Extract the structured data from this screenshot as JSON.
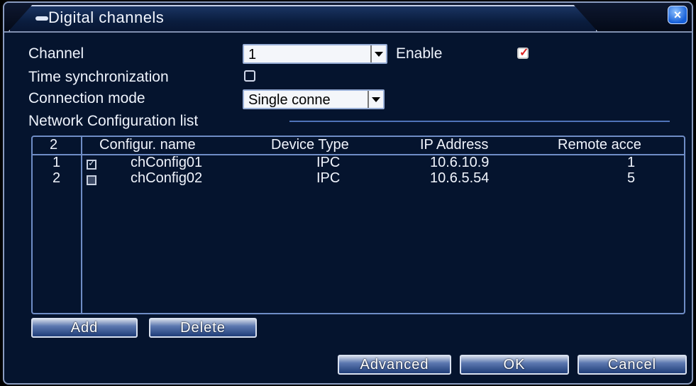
{
  "window": {
    "title": "Digital channels",
    "close_label": "×"
  },
  "form": {
    "channel_label": "Channel",
    "channel_value": "1",
    "enable_label": "Enable",
    "enable_checked": true,
    "time_sync_label": "Time synchronization",
    "time_sync_checked": false,
    "connection_mode_label": "Connection mode",
    "connection_mode_value": "Single conne"
  },
  "network_list": {
    "section_title": "Network Configuration list",
    "count": "2",
    "columns": [
      "Configur. name",
      "Device Type",
      "IP Address",
      "Remote acce"
    ],
    "rows": [
      {
        "index": "1",
        "checked": true,
        "name": "chConfig01",
        "device_type": "IPC",
        "ip": "10.6.10.9",
        "remote": "1"
      },
      {
        "index": "2",
        "checked": false,
        "name": "chConfig02",
        "device_type": "IPC",
        "ip": "10.6.5.54",
        "remote": "5"
      }
    ]
  },
  "buttons": {
    "add": "Add",
    "delete": "Delete",
    "advanced": "Advanced",
    "ok": "OK",
    "cancel": "Cancel"
  },
  "colors": {
    "background": "#05142e",
    "border": "#6f8dc6",
    "check_mark": "#dd2222"
  }
}
